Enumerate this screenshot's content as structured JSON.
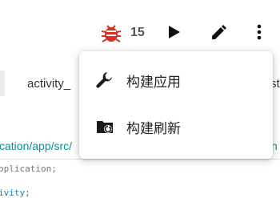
{
  "toolbar": {
    "bug_count": "15",
    "icons": {
      "bug": "bug-icon",
      "play": "play-icon",
      "edit": "pencil-icon",
      "more": "more-vert-icon"
    },
    "bug_color": "#d93025"
  },
  "tabs": {
    "left_label": "activity_",
    "right_label": "st"
  },
  "editor": {
    "path_text": "cation/app/src/",
    "path_right": "n",
    "line1": "pplication;",
    "line2": "ivity;"
  },
  "menu": {
    "items": [
      {
        "label": "构建应用",
        "icon": "wrench-icon"
      },
      {
        "label": "构建刷新",
        "icon": "folder-refresh-icon"
      }
    ]
  }
}
